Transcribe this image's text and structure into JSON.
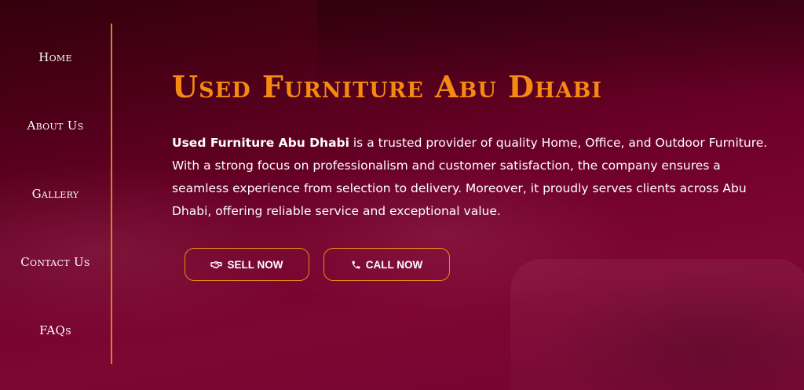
{
  "sidebar": {
    "items": [
      {
        "label": "Home"
      },
      {
        "label": "About Us"
      },
      {
        "label": "Gallery"
      },
      {
        "label": "Contact Us"
      },
      {
        "label": "FAQs"
      }
    ]
  },
  "hero": {
    "title": "Used Furniture Abu Dhabi",
    "description_bold": "Used Furniture Abu Dhabi",
    "description_rest": " is a trusted provider of quality Home, Office, and Outdoor Furniture. With a strong focus on professionalism and customer satisfaction, the company ensures a seamless experience from selection to delivery. Moreover, it proudly serves clients across Abu Dhabi, offering reliable service and exceptional value."
  },
  "buttons": {
    "sell": {
      "label": "SELL NOW",
      "icon": "handshake-icon"
    },
    "call": {
      "label": "CALL NOW",
      "icon": "phone-icon"
    }
  },
  "colors": {
    "accent": "#f58a11",
    "divider": "#d4851c",
    "background": "#6d0028",
    "text": "#ffffff"
  }
}
